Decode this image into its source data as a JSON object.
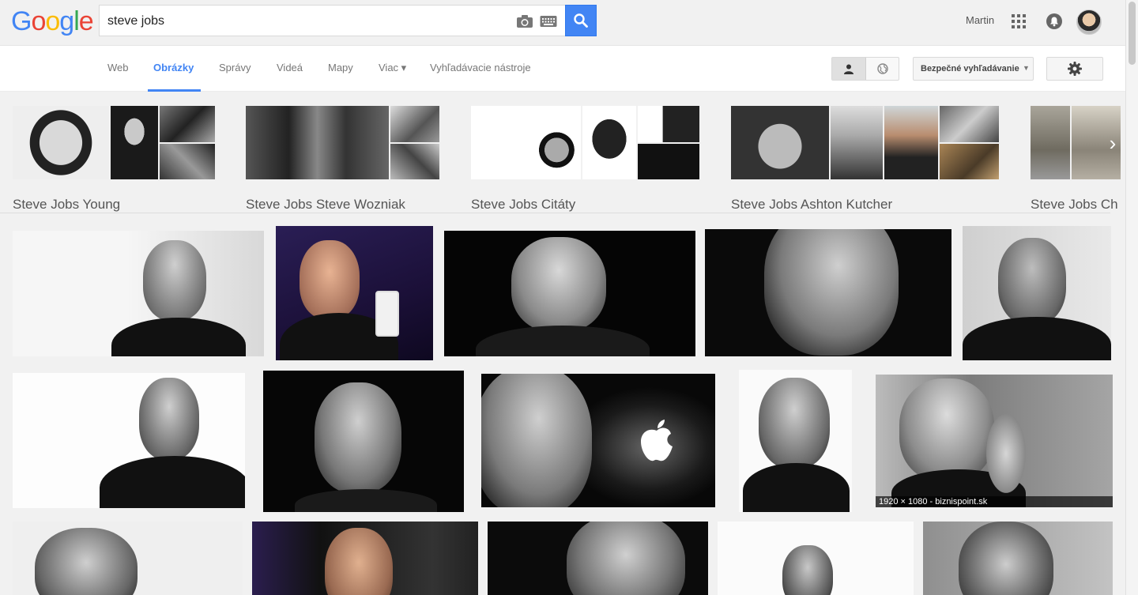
{
  "header": {
    "logo_letters": [
      {
        "ch": "G",
        "color": "#4285f4"
      },
      {
        "ch": "o",
        "color": "#ea4335"
      },
      {
        "ch": "o",
        "color": "#fbbc05"
      },
      {
        "ch": "g",
        "color": "#4285f4"
      },
      {
        "ch": "l",
        "color": "#34a853"
      },
      {
        "ch": "e",
        "color": "#ea4335"
      }
    ],
    "search_value": "steve jobs",
    "user_name": "Martin",
    "icons": [
      "camera-icon",
      "keyboard-icon",
      "search-icon",
      "apps-icon",
      "notifications-icon"
    ]
  },
  "nav": {
    "tabs": [
      {
        "label": "Web",
        "active": false
      },
      {
        "label": "Obrázky",
        "active": true
      },
      {
        "label": "Správy",
        "active": false
      },
      {
        "label": "Videá",
        "active": false
      },
      {
        "label": "Mapy",
        "active": false
      },
      {
        "label": "Viac ▾",
        "active": false
      },
      {
        "label": "Vyhľadávacie nástroje",
        "active": false
      }
    ],
    "safesearch_label": "Bezpečné vyhľadávanie",
    "accent": "#4285f4"
  },
  "related": [
    {
      "label": "Steve Jobs Young"
    },
    {
      "label": "Steve Jobs Steve Wozniak"
    },
    {
      "label": "Steve Jobs Citáty"
    },
    {
      "label": "Steve Jobs Ashton Kutcher"
    },
    {
      "label": "Steve Jobs Ch"
    }
  ],
  "results": {
    "hover_caption": "1920 × 1080 - biznispoint.sk"
  }
}
